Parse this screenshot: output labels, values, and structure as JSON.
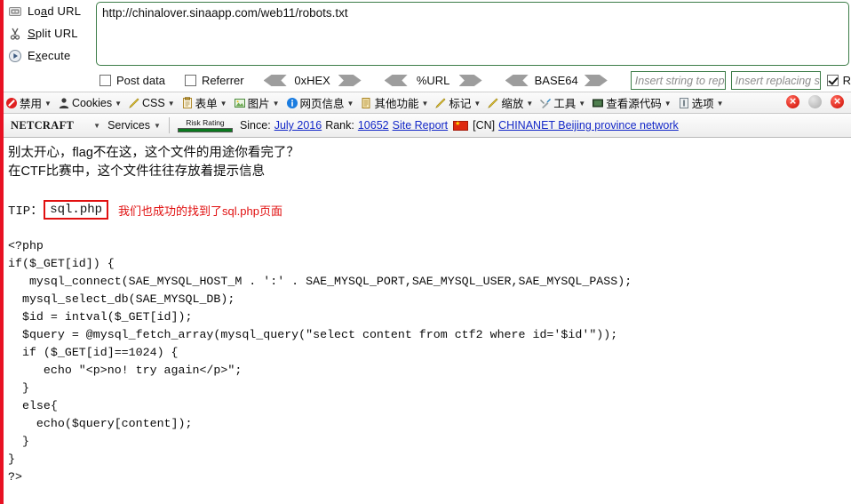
{
  "hackbar": {
    "actions": [
      {
        "icon": "load-url-icon",
        "label_pre": "Lo",
        "label_key": "a",
        "label_post": "d URL",
        "full": "Load URL"
      },
      {
        "icon": "split-url-icon",
        "label_pre": "",
        "label_key": "S",
        "label_post": "plit URL",
        "full": "Split URL"
      },
      {
        "icon": "execute-icon",
        "label_pre": "E",
        "label_key": "x",
        "label_post": "ecute",
        "full": "Execute"
      }
    ],
    "url_value": "http://chinalover.sinaapp.com/web11/robots.txt",
    "options": {
      "post_data_label": "Post data",
      "post_data_checked": false,
      "referrer_label": "Referrer",
      "referrer_checked": false,
      "encoders": [
        {
          "label": "0xHEX"
        },
        {
          "label": "%URL"
        },
        {
          "label": "BASE64"
        }
      ],
      "replace_from_placeholder": "Insert string to replace",
      "replace_to_placeholder": "Insert replacing string",
      "replace_checkbox_label": "R",
      "replace_checkbox_checked": true
    },
    "accent_border": "#3c7c47"
  },
  "webdev_toolbar": {
    "items": [
      {
        "icon": "disable-icon",
        "label": "禁用"
      },
      {
        "icon": "cookies-icon",
        "label": "Cookies"
      },
      {
        "icon": "css-icon",
        "label": "CSS"
      },
      {
        "icon": "forms-icon",
        "label": "表单"
      },
      {
        "icon": "images-icon",
        "label": "图片"
      },
      {
        "icon": "page-info-icon",
        "label": "网页信息"
      },
      {
        "icon": "misc-icon",
        "label": "其他功能"
      },
      {
        "icon": "outline-icon",
        "label": "标记"
      },
      {
        "icon": "resize-icon",
        "label": "缩放"
      },
      {
        "icon": "tools-icon",
        "label": "工具"
      },
      {
        "icon": "view-source-icon",
        "label": "查看源代码"
      },
      {
        "icon": "options-icon",
        "label": "选项"
      }
    ],
    "status_dots": [
      "error",
      "idle",
      "error"
    ]
  },
  "netcraft_toolbar": {
    "logo": "NETCRAFT",
    "services_label": "Services",
    "risk_rating_label": "Risk Rating",
    "since_label": "Since:",
    "since_value": "July 2016",
    "rank_label": "Rank:",
    "rank_value": "10652",
    "site_report_label": "Site Report",
    "country_code": "[CN]",
    "network_name": "CHINANET Beijing province network",
    "link_color": "#1428c8"
  },
  "page": {
    "lines": [
      "别太开心，flag不在这，这个文件的用途你看完了？",
      "在CTF比赛中，这个文件往往存放着提示信息"
    ],
    "tip_label": "TIP：",
    "tip_value": "sql.php",
    "tip_note": "我们也成功的找到了sql.php页面",
    "tip_accent": "#e11010",
    "code": "<?php\nif($_GET[id]) {\n   mysql_connect(SAE_MYSQL_HOST_M . ':' . SAE_MYSQL_PORT,SAE_MYSQL_USER,SAE_MYSQL_PASS);\n  mysql_select_db(SAE_MYSQL_DB);\n  $id = intval($_GET[id]);\n  $query = @mysql_fetch_array(mysql_query(\"select content from ctf2 where id='$id'\"));\n  if ($_GET[id]==1024) {\n     echo \"<p>no! try again</p>\";\n  }\n  else{\n    echo($query[content]);\n  }\n}\n?>"
  }
}
